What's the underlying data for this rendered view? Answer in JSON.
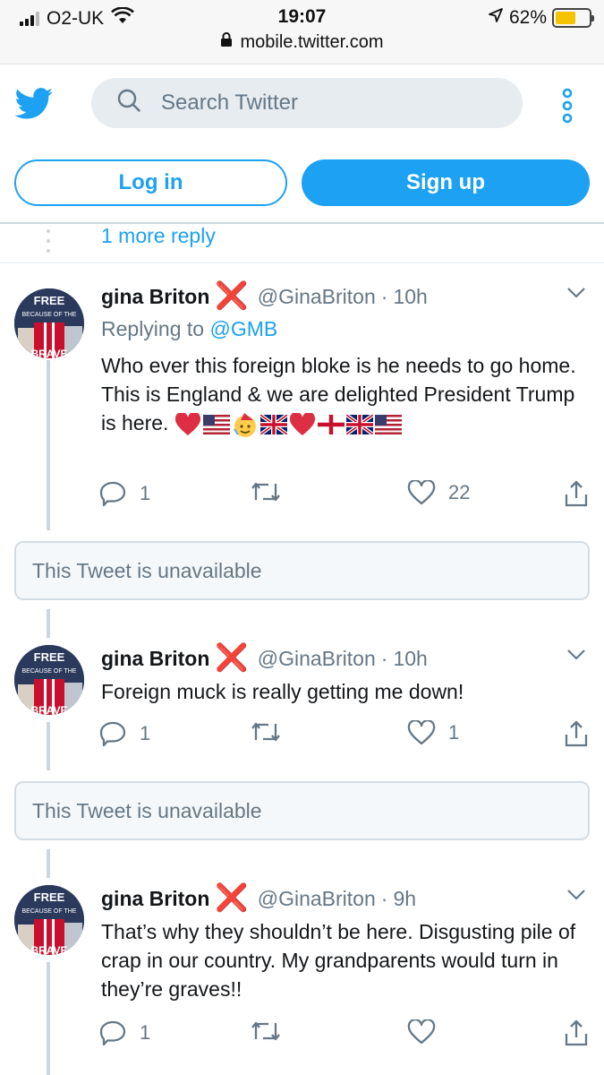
{
  "status_bar": {
    "carrier": "O2-UK",
    "time": "19:07",
    "battery_percent": "62%",
    "battery_level": 0.62,
    "url": "mobile.twitter.com",
    "battery_color": "#f5c400"
  },
  "header": {
    "search_placeholder": "Search Twitter",
    "login_label": "Log in",
    "signup_label": "Sign up",
    "brand_color": "#1da1f2"
  },
  "thread": {
    "more_reply_label": "1 more reply"
  },
  "tweets": [
    {
      "name": "gina Briton",
      "handle": "@GinaBriton",
      "time": "10h",
      "replying_prefix": "Replying to",
      "replying_to": "@GMB",
      "text": "Who ever this foreign bloke is he needs to go home. This is England & we are delighted President Trump is here.",
      "emojis": [
        "red-heart",
        "us-flag",
        "party-face",
        "uk-flag",
        "red-heart",
        "england-flag",
        "uk-flag",
        "us-flag"
      ],
      "replies": "1",
      "retweets": "",
      "likes": "22"
    },
    {
      "name": "gina Briton",
      "handle": "@GinaBriton",
      "time": "10h",
      "text": "Foreign muck is really getting me down!",
      "replies": "1",
      "retweets": "",
      "likes": "1"
    },
    {
      "name": "gina Briton",
      "handle": "@GinaBriton",
      "time": "9h",
      "text": "That’s why they shouldn’t be here. Disgusting pile of crap in our country. My grandparents would turn in they’re graves!!",
      "replies": "1",
      "retweets": "",
      "likes": ""
    }
  ],
  "unavailable_label": "This Tweet is unavailable",
  "avatar": {
    "top_text": "FREE",
    "middle_text": "BECAUSE OF THE",
    "bottom_text": "BRAVE"
  },
  "separator": "·"
}
